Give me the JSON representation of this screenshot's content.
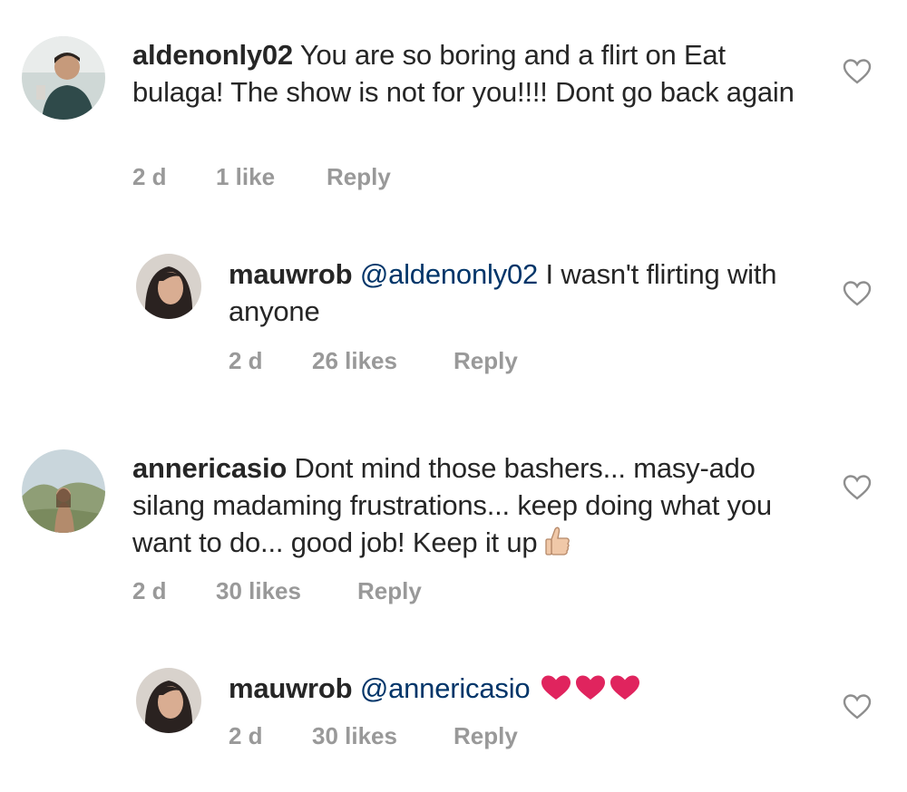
{
  "comments": [
    {
      "username": "aldenonly02",
      "mention": "",
      "text": "You are so boring and a flirt  on Eat bulaga! The show is not for you!!!! Dont go back again",
      "time": "2 d",
      "likes": "1 like",
      "reply": "Reply"
    },
    {
      "username": "mauwrob",
      "mention": "@aldenonly02",
      "text": "I wasn't flirting with anyone",
      "time": "2 d",
      "likes": "26 likes",
      "reply": "Reply"
    },
    {
      "username": "annericasio",
      "mention": "",
      "text": "Dont mind those bashers... masy-ado silang madaming frustrations... keep doing what you want to do... good job! Keep it up",
      "time": "2 d",
      "likes": "30 likes",
      "reply": "Reply"
    },
    {
      "username": "mauwrob",
      "mention": "@annericasio",
      "text": "",
      "time": "2 d",
      "likes": "30 likes",
      "reply": "Reply"
    }
  ],
  "icons": {
    "like": "heart-outline-icon",
    "thumb_emoji": "thumbs-up-emoji-icon",
    "heart_emoji": "red-heart-emoji-icon"
  },
  "colors": {
    "text": "#262626",
    "meta": "#999999",
    "mention": "#003569",
    "heart_emoji": "#e0245e"
  }
}
